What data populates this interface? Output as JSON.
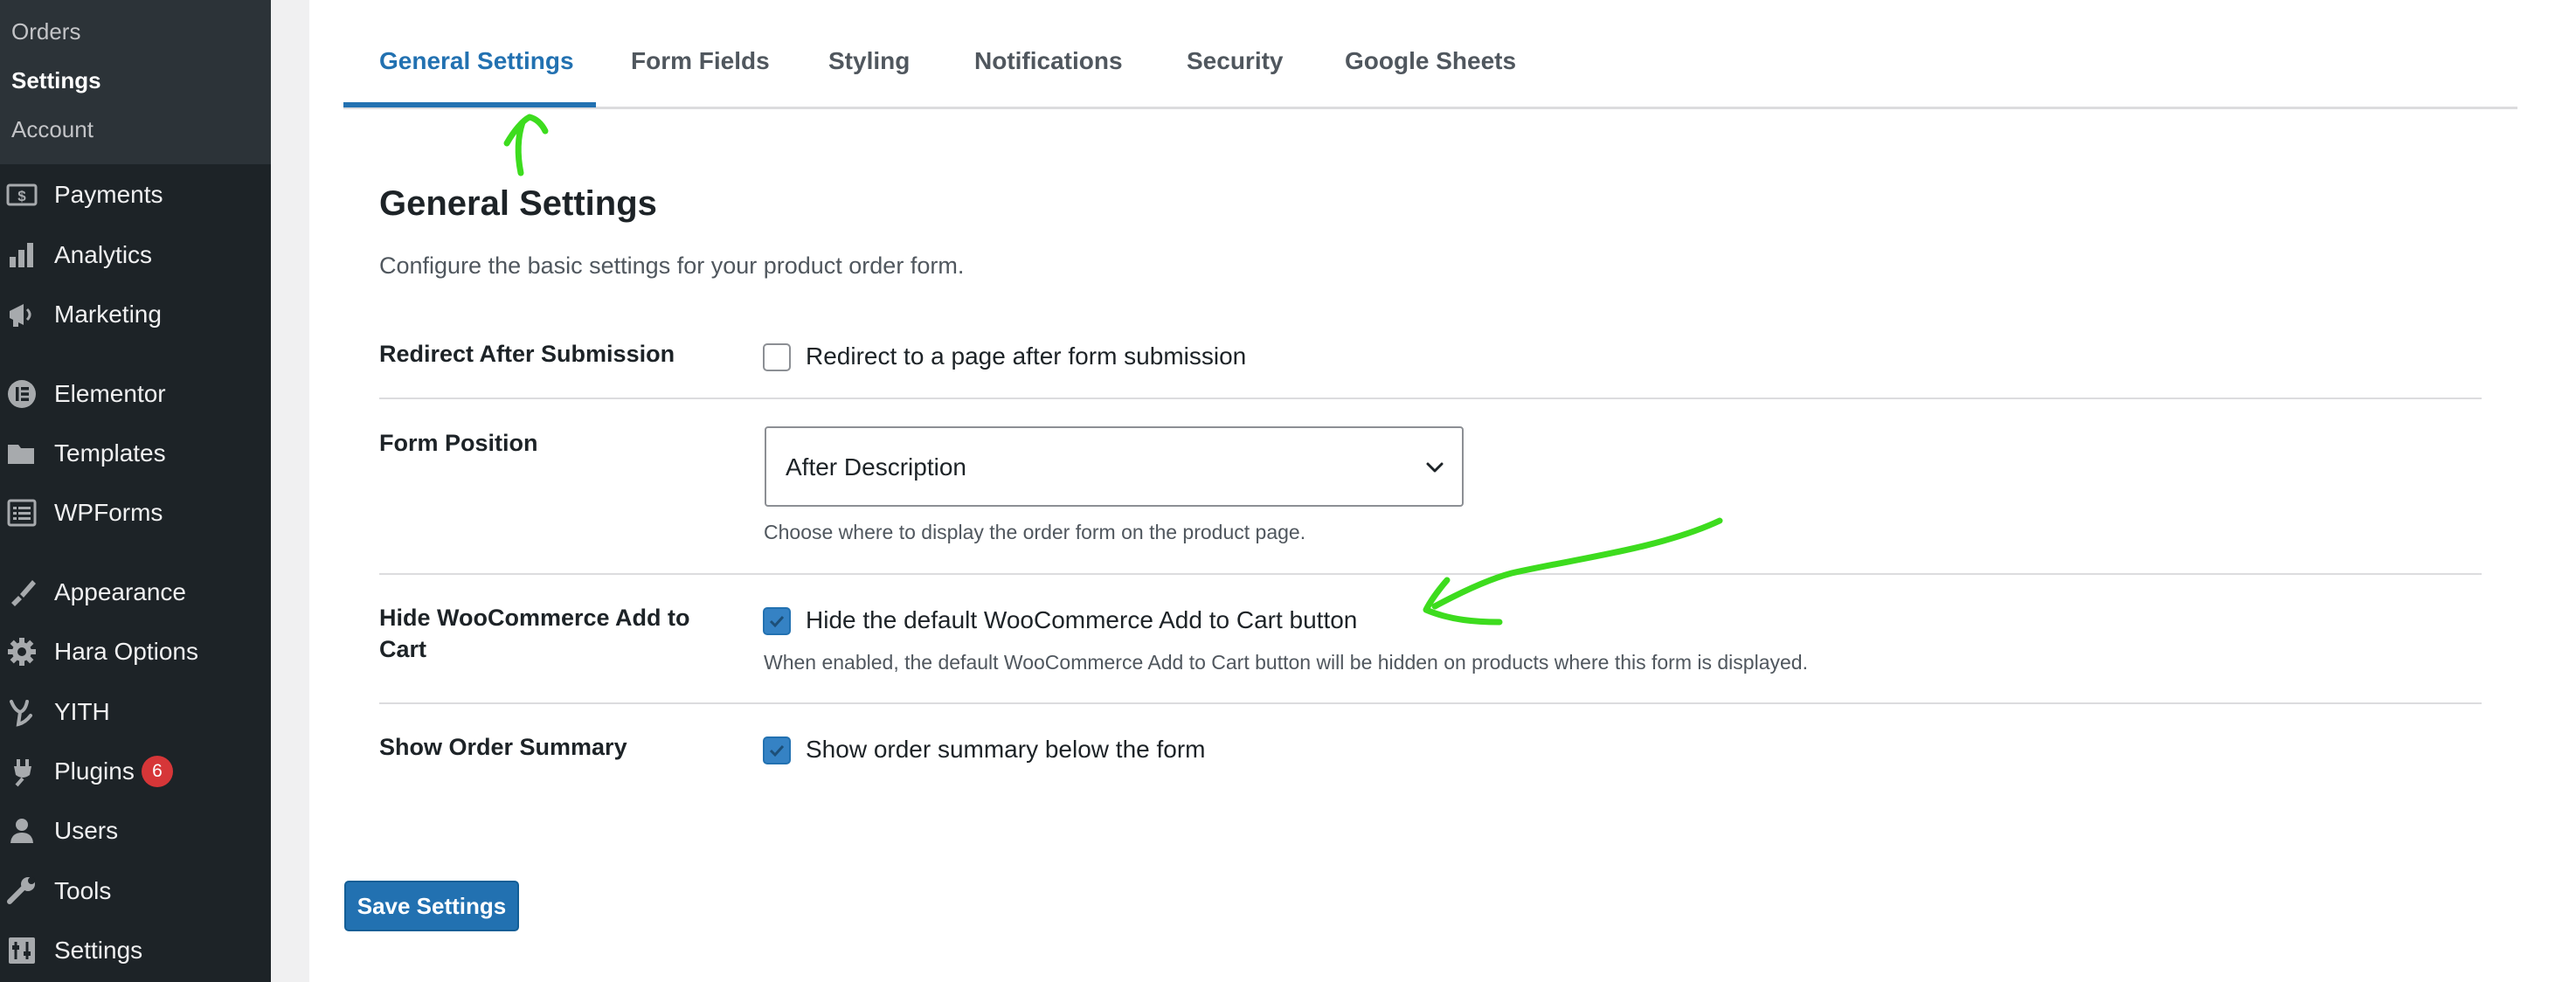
{
  "sidebar": {
    "submenu": [
      {
        "label": "Orders"
      },
      {
        "label": "Settings"
      },
      {
        "label": "Account"
      }
    ],
    "items": [
      {
        "label": "Payments",
        "icon": "payments-icon"
      },
      {
        "label": "Analytics",
        "icon": "analytics-icon"
      },
      {
        "label": "Marketing",
        "icon": "marketing-icon"
      },
      {
        "label": "Elementor",
        "icon": "elementor-icon"
      },
      {
        "label": "Templates",
        "icon": "templates-icon"
      },
      {
        "label": "WPForms",
        "icon": "wpforms-icon"
      },
      {
        "label": "Appearance",
        "icon": "appearance-icon"
      },
      {
        "label": "Hara Options",
        "icon": "gear-icon"
      },
      {
        "label": "YITH",
        "icon": "yith-icon"
      },
      {
        "label": "Plugins",
        "icon": "plugins-icon",
        "badge": "6"
      },
      {
        "label": "Users",
        "icon": "users-icon"
      },
      {
        "label": "Tools",
        "icon": "tools-icon"
      },
      {
        "label": "Settings",
        "icon": "settings-icon"
      }
    ]
  },
  "tabs": [
    {
      "label": "General Settings",
      "active": true
    },
    {
      "label": "Form Fields"
    },
    {
      "label": "Styling"
    },
    {
      "label": "Notifications"
    },
    {
      "label": "Security"
    },
    {
      "label": "Google Sheets"
    }
  ],
  "section": {
    "title": "General Settings",
    "description": "Configure the basic settings for your product order form."
  },
  "fields": {
    "redirect": {
      "label": "Redirect After Submission",
      "checkbox_label": "Redirect to a page after form submission",
      "checked": false
    },
    "form_position": {
      "label": "Form Position",
      "value": "After Description",
      "help": "Choose where to display the order form on the product page."
    },
    "hide_add_to_cart": {
      "label": "Hide WooCommerce Add to Cart",
      "checkbox_label": "Hide the default WooCommerce Add to Cart button",
      "checked": true,
      "help": "When enabled, the default WooCommerce Add to Cart button will be hidden on products where this form is displayed."
    },
    "order_summary": {
      "label": "Show Order Summary",
      "checkbox_label": "Show order summary below the form",
      "checked": true
    }
  },
  "actions": {
    "save_label": "Save Settings"
  },
  "colors": {
    "accent": "#2271b1",
    "sidebar_bg": "#1d2327",
    "annotation": "#3ddc1e",
    "badge": "#d63638"
  }
}
